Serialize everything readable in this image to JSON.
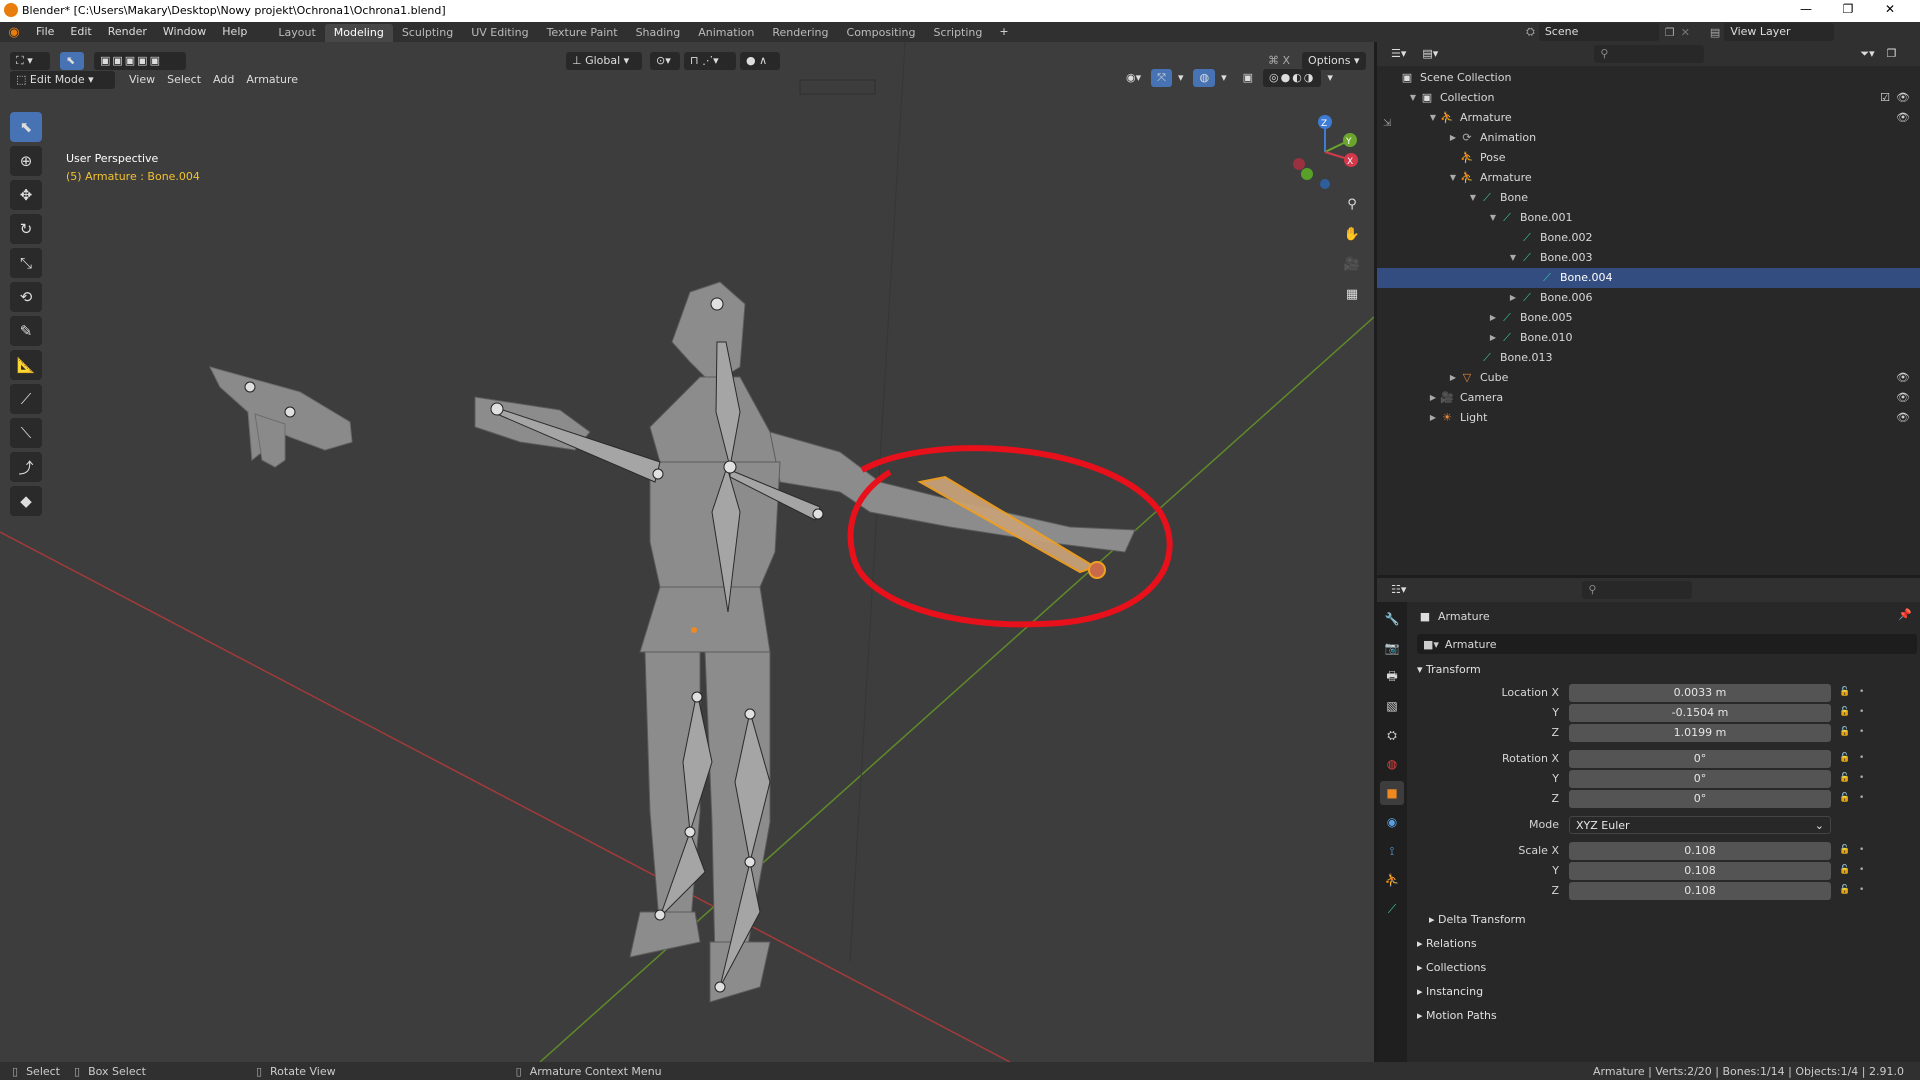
{
  "window": {
    "title": "Blender* [C:\\Users\\Makary\\Desktop\\Nowy projekt\\Ochrona1\\Ochrona1.blend]",
    "min": "—",
    "max": "❐",
    "close": "✕"
  },
  "menu": [
    "File",
    "Edit",
    "Render",
    "Window",
    "Help"
  ],
  "workspaces": [
    "Layout",
    "Modeling",
    "Sculpting",
    "UV Editing",
    "Texture Paint",
    "Shading",
    "Animation",
    "Rendering",
    "Compositing",
    "Scripting"
  ],
  "active_workspace": "Modeling",
  "add_workspace": "+",
  "scene": {
    "label": "Scene",
    "view_layer": "View Layer"
  },
  "viewport": {
    "mode": "Edit Mode",
    "header_menus": [
      "View",
      "Select",
      "Add",
      "Armature"
    ],
    "transform_orientation": "Global",
    "options": "Options",
    "view_name": "User Perspective",
    "context": "(5) Armature : Bone.004",
    "gizmo": {
      "x": "X",
      "y": "Y",
      "z": "Z"
    }
  },
  "outliner": {
    "root": "Scene Collection",
    "items": [
      {
        "label": "Collection",
        "level": 1,
        "icon": "collection-icon",
        "caret": "▼"
      },
      {
        "label": "Armature",
        "level": 2,
        "icon": "armature-object-icon",
        "caret": "▼"
      },
      {
        "label": "Animation",
        "level": 3,
        "icon": "animation-icon",
        "caret": "▶"
      },
      {
        "label": "Pose",
        "level": 3,
        "icon": "pose-icon",
        "caret": ""
      },
      {
        "label": "Armature",
        "level": 3,
        "icon": "armature-data-icon",
        "caret": "▼"
      },
      {
        "label": "Bone",
        "level": 4,
        "icon": "bone-icon",
        "caret": "▼"
      },
      {
        "label": "Bone.001",
        "level": 5,
        "icon": "bone-icon",
        "caret": "▼"
      },
      {
        "label": "Bone.002",
        "level": 6,
        "icon": "bone-icon",
        "caret": ""
      },
      {
        "label": "Bone.003",
        "level": 6,
        "icon": "bone-icon",
        "caret": "▼"
      },
      {
        "label": "Bone.004",
        "level": 7,
        "icon": "bone-icon",
        "caret": "",
        "selected": true
      },
      {
        "label": "Bone.006",
        "level": 6,
        "icon": "bone-icon",
        "caret": "▶"
      },
      {
        "label": "Bone.005",
        "level": 5,
        "icon": "bone-icon",
        "caret": "▶"
      },
      {
        "label": "Bone.010",
        "level": 5,
        "icon": "bone-icon",
        "caret": "▶"
      },
      {
        "label": "Bone.013",
        "level": 4,
        "icon": "bone-icon",
        "caret": ""
      },
      {
        "label": "Cube",
        "level": 3,
        "icon": "mesh-icon",
        "caret": "▶"
      },
      {
        "label": "Camera",
        "level": 2,
        "icon": "camera-icon",
        "caret": "▶"
      },
      {
        "label": "Light",
        "level": 2,
        "icon": "light-icon",
        "caret": "▶"
      }
    ]
  },
  "properties": {
    "object_name": "Armature",
    "data_name": "Armature",
    "transform_header": "Transform",
    "location": {
      "label": "Location X",
      "y_label": "Y",
      "z_label": "Z",
      "x": "0.0033 m",
      "y": "-0.1504 m",
      "z": "1.0199 m"
    },
    "rotation": {
      "label": "Rotation X",
      "y_label": "Y",
      "z_label": "Z",
      "x": "0°",
      "y": "0°",
      "z": "0°"
    },
    "mode": {
      "label": "Mode",
      "value": "XYZ Euler"
    },
    "scale": {
      "label": "Scale X",
      "y_label": "Y",
      "z_label": "Z",
      "x": "0.108",
      "y": "0.108",
      "z": "0.108"
    },
    "sections": [
      "Delta Transform",
      "Relations",
      "Collections",
      "Instancing",
      "Motion Paths"
    ]
  },
  "status": {
    "select": "Select",
    "box_select": "Box Select",
    "rotate_view": "Rotate View",
    "context_menu": "Armature Context Menu",
    "stats": "Armature | Verts:2/20 | Bones:1/14 | Objects:1/4 | 2.91.0"
  },
  "colors": {
    "accent": "#4772b3",
    "selection_row": "#334d80",
    "annotation": "#e8101a",
    "context_text": "#f1c232"
  }
}
